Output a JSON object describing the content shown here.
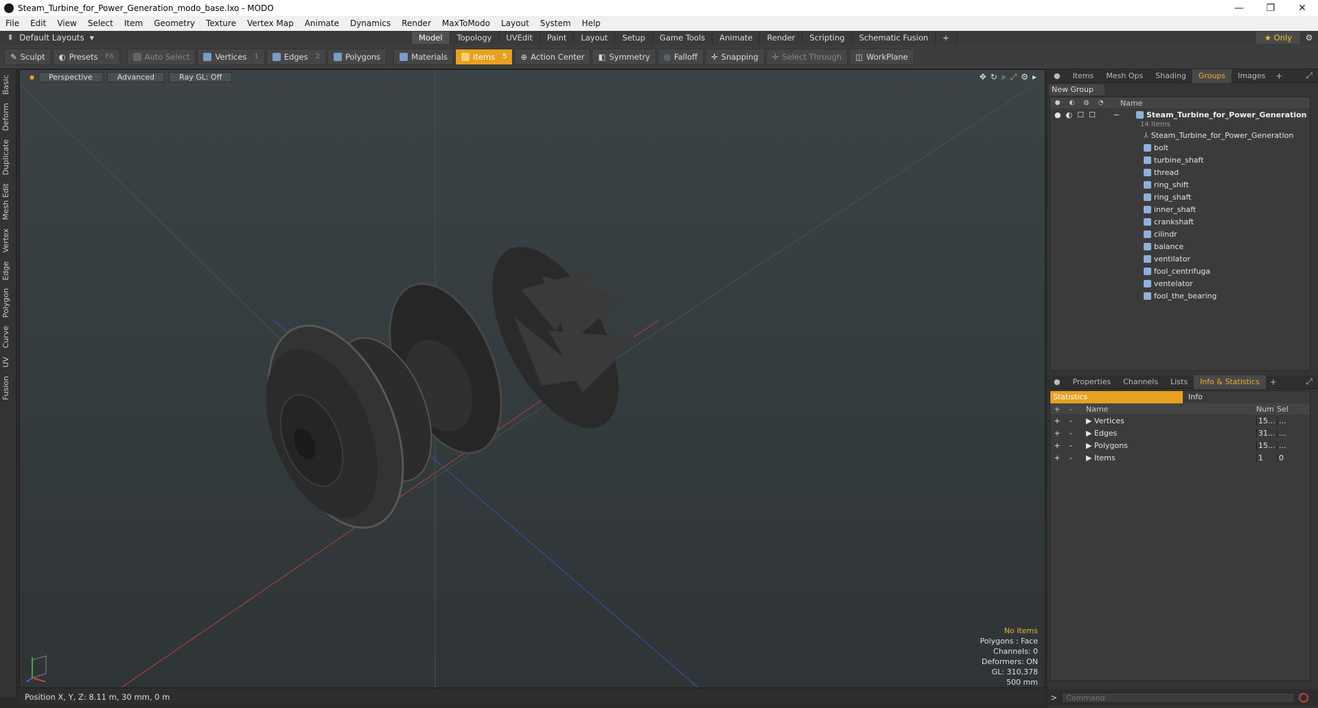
{
  "window": {
    "title": "Steam_Turbine_for_Power_Generation_modo_base.lxo - MODO"
  },
  "menu": [
    "File",
    "Edit",
    "View",
    "Select",
    "Item",
    "Geometry",
    "Texture",
    "Vertex Map",
    "Animate",
    "Dynamics",
    "Render",
    "MaxToModo",
    "Layout",
    "System",
    "Help"
  ],
  "modebar": {
    "layouts": "Default Layouts",
    "tabs": [
      "Model",
      "Topology",
      "UVEdit",
      "Paint",
      "Layout",
      "Setup",
      "Game Tools",
      "Animate",
      "Render",
      "Scripting",
      "Schematic Fusion"
    ],
    "active_tab": "Model",
    "only_label": "Only"
  },
  "toolbar": {
    "sculpt": "Sculpt",
    "presets": "Presets",
    "presets_key": "F6",
    "auto_select": "Auto Select",
    "vertices": "Vertices",
    "vertices_key": "1",
    "edges": "Edges",
    "edges_key": "2",
    "polygons": "Polygons",
    "materials": "Materials",
    "items": "Items",
    "items_key": "5",
    "action_center": "Action Center",
    "symmetry": "Symmetry",
    "falloff": "Falloff",
    "snapping": "Snapping",
    "select_through": "Select Through",
    "workplane": "WorkPlane"
  },
  "left_tabs": [
    "Basic",
    "Deform",
    "Duplicate",
    "Mesh Edit",
    "Vertex",
    "Edge",
    "Polygon",
    "Curve",
    "UV",
    "Fusion"
  ],
  "viewport": {
    "view": "Perspective",
    "shading": "Advanced",
    "raygl": "Ray GL: Off",
    "hud": {
      "selection": "No Items",
      "polygons": "Polygons : Face",
      "channels": "Channels: 0",
      "deformers": "Deformers: ON",
      "gl": "GL: 310,378",
      "scale": "500 mm"
    }
  },
  "status": {
    "position": "Position X, Y, Z:  8.11 m, 30 mm, 0 m"
  },
  "top_panel": {
    "tabs": [
      "Items",
      "Mesh Ops",
      "Shading",
      "Groups",
      "Images"
    ],
    "active": "Groups",
    "new_group": "New Group",
    "col_name": "Name",
    "group_name": "Steam_Turbine_for_Power_Generation",
    "group_sub": "14 Items",
    "items": [
      "Steam_Turbine_for_Power_Generation",
      "bolt",
      "turbine_shaft",
      "thread",
      "ring_shift",
      "ring_shaft",
      "inner_shaft",
      "crankshaft",
      "cilindr",
      "balance",
      "ventilator",
      "fool_centrifuga",
      "ventelator",
      "fool_the_bearing"
    ]
  },
  "bottom_panel": {
    "tabs": [
      "Properties",
      "Channels",
      "Lists",
      "Info & Statistics"
    ],
    "active": "Info & Statistics",
    "sub_tabs": [
      "Statistics",
      "Info"
    ],
    "cols": {
      "name": "Name",
      "num": "Num",
      "sel": "Sel"
    },
    "rows": [
      {
        "name": "Vertices",
        "num": "15...",
        "sel": "..."
      },
      {
        "name": "Edges",
        "num": "31...",
        "sel": "..."
      },
      {
        "name": "Polygons",
        "num": "15...",
        "sel": "..."
      },
      {
        "name": "Items",
        "num": "1",
        "sel": "0"
      }
    ]
  },
  "command": {
    "placeholder": "Command"
  },
  "colors": {
    "accent": "#e8a020",
    "viewport_bg": "#363d40"
  }
}
